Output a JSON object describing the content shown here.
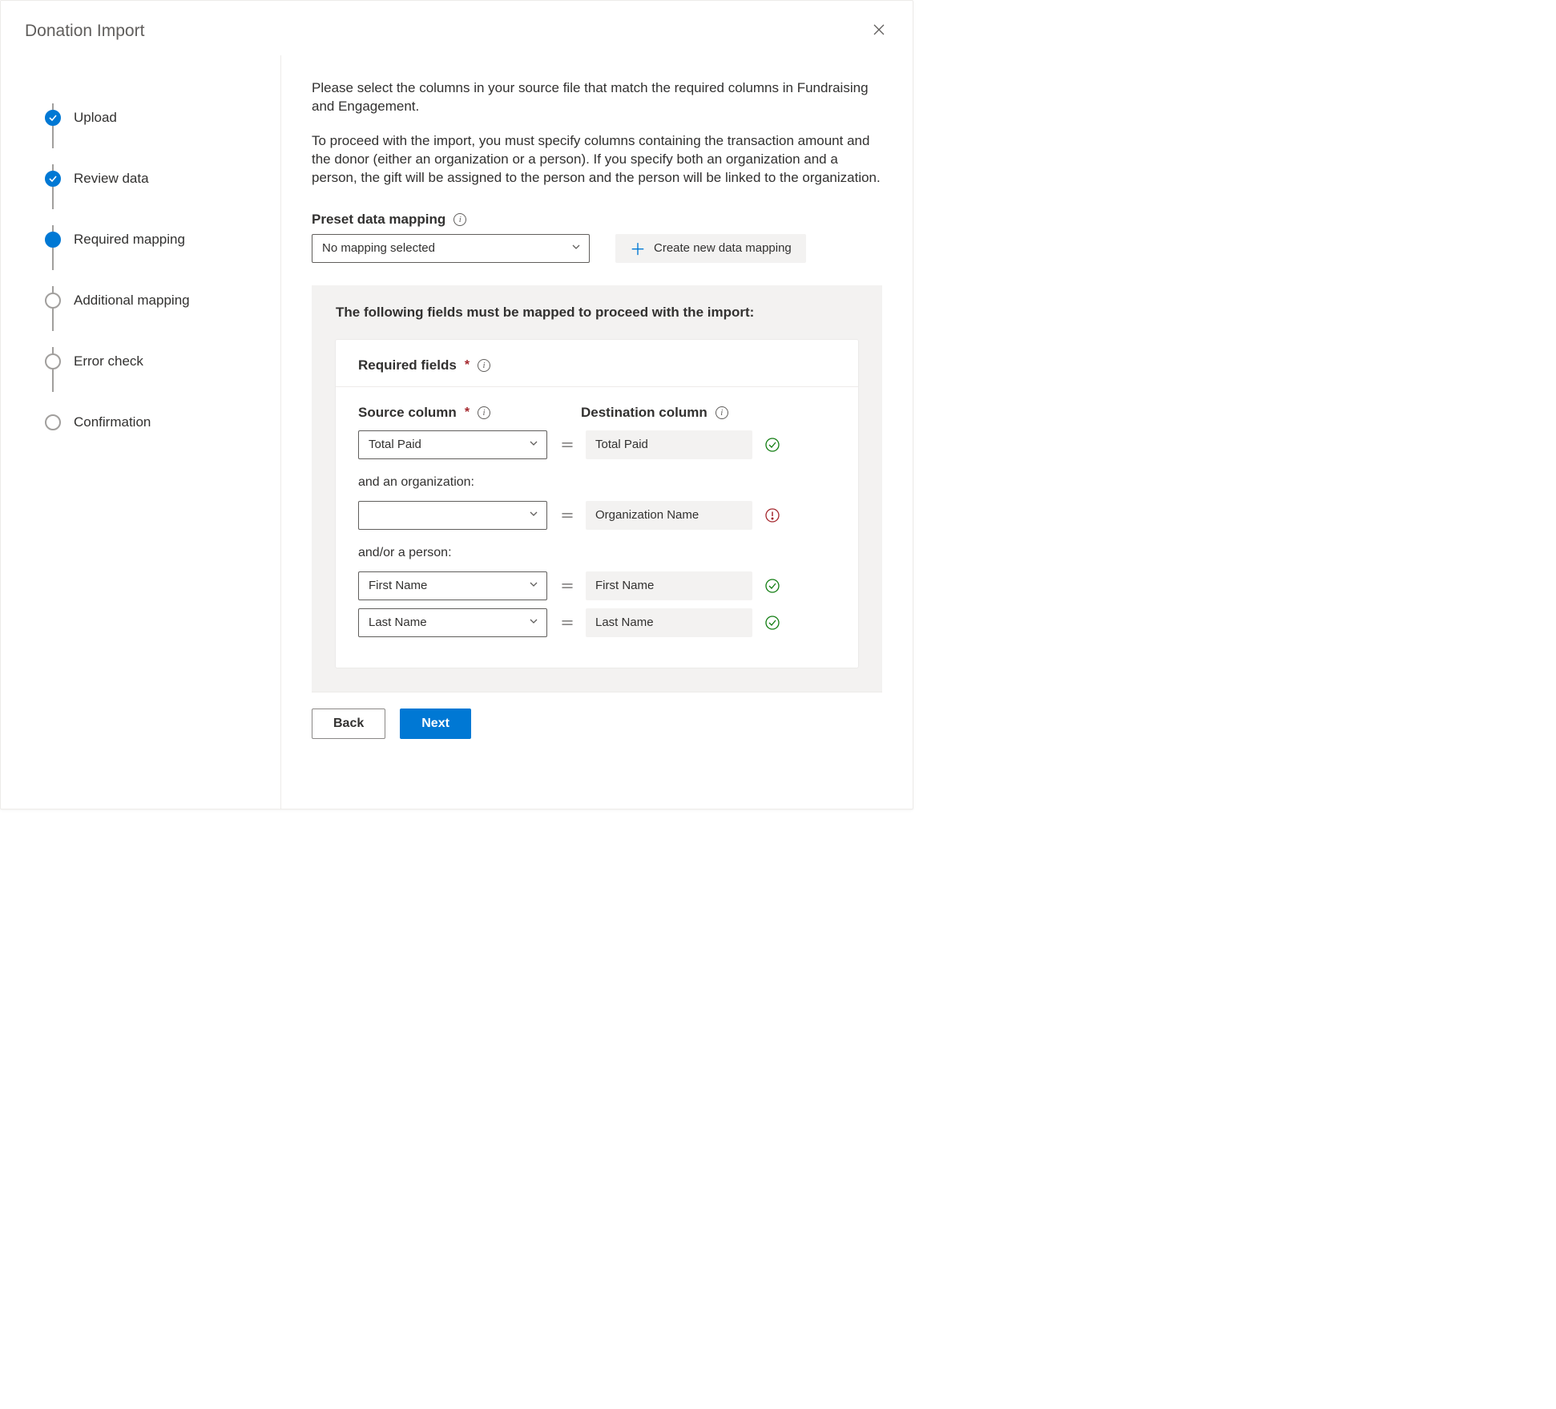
{
  "dialog": {
    "title": "Donation Import"
  },
  "steps": [
    {
      "label": "Upload",
      "state": "done"
    },
    {
      "label": "Review data",
      "state": "done"
    },
    {
      "label": "Required mapping",
      "state": "current"
    },
    {
      "label": "Additional mapping",
      "state": "pending"
    },
    {
      "label": "Error check",
      "state": "pending"
    },
    {
      "label": "Confirmation",
      "state": "pending"
    }
  ],
  "intro": {
    "p1": "Please select the columns in your source file that match the required columns in Fundraising and Engagement.",
    "p2": "To proceed with the import, you must specify columns containing the transaction amount and the donor (either an organization or a person). If you specify both an organization and a person, the gift will be assigned to the person and the person will be linked to the organization."
  },
  "preset": {
    "label": "Preset data mapping",
    "value": "No mapping selected",
    "create_label": "Create new data mapping"
  },
  "panel": {
    "title": "The following fields must be mapped to proceed with the import:",
    "card_title": "Required fields",
    "source_col_label": "Source column",
    "dest_col_label": "Destination column",
    "and_org": "and an organization:",
    "and_person": "and/or a person:"
  },
  "rows": {
    "total_paid": {
      "source": "Total Paid",
      "dest": "Total Paid",
      "status": "ok"
    },
    "organization": {
      "source": "",
      "dest": "Organization Name",
      "status": "err"
    },
    "first_name": {
      "source": "First Name",
      "dest": "First Name",
      "status": "ok"
    },
    "last_name": {
      "source": "Last Name",
      "dest": "Last Name",
      "status": "ok"
    }
  },
  "footer": {
    "back": "Back",
    "next": "Next"
  }
}
